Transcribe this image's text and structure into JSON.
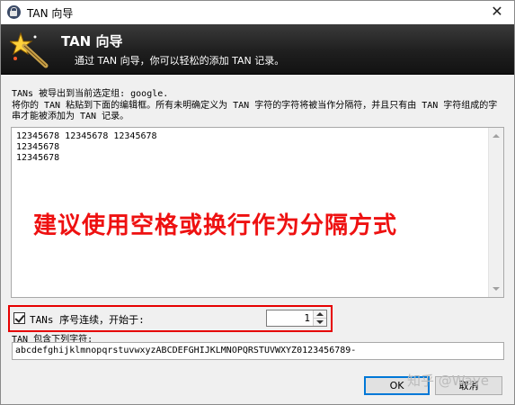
{
  "window": {
    "title": "TAN 向导",
    "close_glyph": "✕"
  },
  "banner": {
    "title": "TAN 向导",
    "subtitle": "通过 TAN 向导，你可以轻松的添加 TAN 记录。",
    "icon": "magic-wand-icon"
  },
  "info": {
    "line1": "TANs 被导出到当前选定组: google.",
    "line2": "将你的 TAN 粘贴到下面的编辑框。所有未明确定义为 TAN 字符的字符将被当作分隔符，并且只有由 TAN 字符组成的字串才能被添加为 TAN 记录。"
  },
  "editor": {
    "content": "12345678 12345678 12345678\n12345678\n12345678"
  },
  "overlay_text": "建议使用空格或换行作为分隔方式",
  "sequence": {
    "checked": true,
    "label": "TANs 序号连续，开始于:",
    "start_value": "1"
  },
  "tan_chars": {
    "label": "TAN 包含下列字符:",
    "value": "abcdefghijklmnopqrstuvwxyzABCDEFGHIJKLMNOPQRSTUVWXYZ0123456789-"
  },
  "buttons": {
    "ok": "OK",
    "cancel": "取消"
  },
  "watermark": "知乎 @Waye",
  "colors": {
    "highlight_red": "#e60000",
    "overlay_red": "#ee1111",
    "banner_dark": "#1f1f1f"
  }
}
